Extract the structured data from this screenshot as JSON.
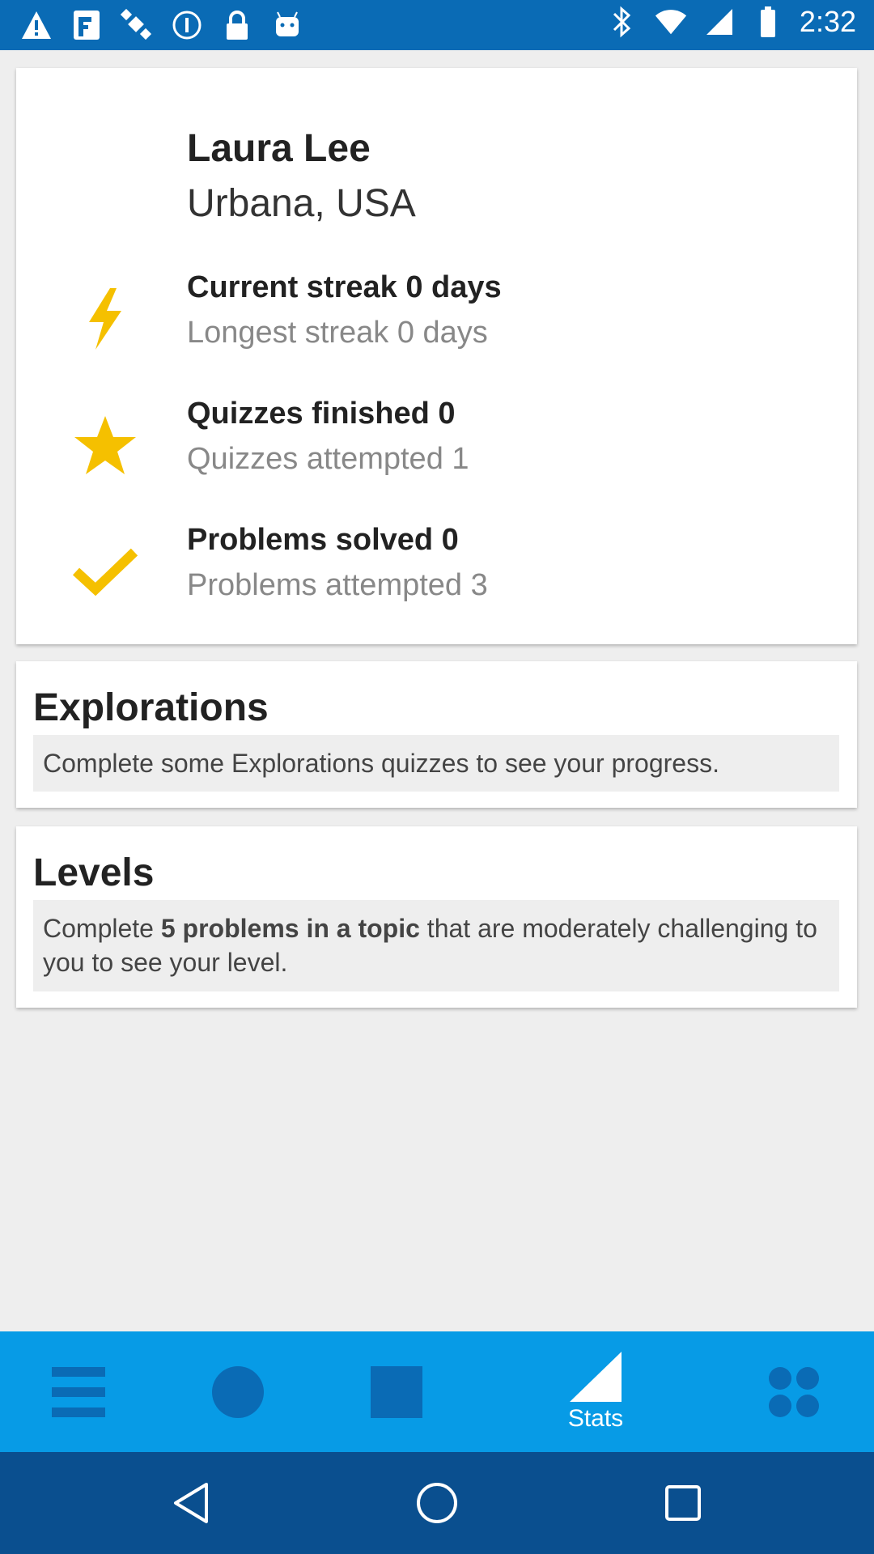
{
  "status_bar": {
    "time": "2:32",
    "left_icons": [
      "warning-icon",
      "fake-gps-icon",
      "satellite-icon",
      "info-circle-icon",
      "lock-icon",
      "android-icon"
    ],
    "right_icons": [
      "bluetooth-icon",
      "wifi-icon",
      "signal-icon",
      "battery-icon"
    ]
  },
  "profile": {
    "name": "Laura Lee",
    "location": "Urbana, USA",
    "stats": [
      {
        "icon": "lightning-icon",
        "primary": "Current streak 0 days",
        "secondary": "Longest streak 0 days"
      },
      {
        "icon": "star-icon",
        "primary": "Quizzes finished 0",
        "secondary": "Quizzes attempted 1"
      },
      {
        "icon": "check-icon",
        "primary": "Problems solved 0",
        "secondary": "Problems attempted 3"
      }
    ]
  },
  "explorations": {
    "title": "Explorations",
    "message": "Complete some Explorations quizzes to see your progress."
  },
  "levels": {
    "title": "Levels",
    "message_pre": "Complete ",
    "message_bold": "5 problems in a topic",
    "message_post": " that are moderately challenging to you to see your level."
  },
  "bottom_nav": {
    "items": [
      {
        "icon": "menu-icon",
        "label": ""
      },
      {
        "icon": "circle-icon",
        "label": ""
      },
      {
        "icon": "square-icon",
        "label": ""
      },
      {
        "icon": "triangle-icon",
        "label": "Stats"
      },
      {
        "icon": "grid-icon",
        "label": ""
      }
    ],
    "active": "Stats"
  },
  "colors": {
    "status_bar": "#0a6bb5",
    "bottom_nav": "#079be6",
    "system_nav": "#0a4f8f",
    "icon_accent": "#f5c000"
  }
}
